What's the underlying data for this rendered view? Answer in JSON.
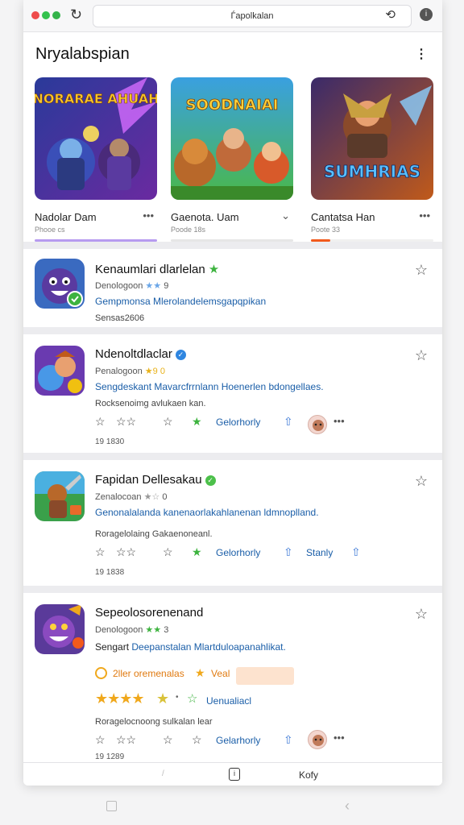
{
  "browser": {
    "url": "Ѓapolkalan",
    "reload_icon": "reload-icon",
    "action_icon": "refresh-icon",
    "info_icon": "info-icon"
  },
  "header": {
    "title": "Nryalabspian",
    "menu_icon": "more-vert-icon"
  },
  "carousel": [
    {
      "art": "NORARAE AHUAH",
      "title": "Nadolar Dam",
      "subtitle": "Phooe cs",
      "bar_color": "#b79bf0",
      "bar_fraction": 1.0
    },
    {
      "art": "SOODNAIAI",
      "title": "Gaenota. Uam",
      "subtitle": "Poode 18s",
      "bar_color": "#e6e6e6",
      "bar_fraction": 1.0
    },
    {
      "art": "SUMHRIAS",
      "title": "Cantatsa Han",
      "subtitle": "Poote 33",
      "bar_color": "#f25a1c",
      "bar_fraction": 0.16
    }
  ],
  "apps": [
    {
      "name": "Kenaumlari dlarlelan",
      "meta": "Denologoon",
      "rating": "9",
      "desc": "Gempmonsa Mlerolandelemsgapqpikan",
      "sub": "Sensas2606",
      "icon": "app-icon-purple-creature"
    },
    {
      "name": "Ndenoltdlaclar",
      "meta": "Penalogoon",
      "rating": "9 0",
      "desc_link": "Sengdeskant Mavarcfrrnlann",
      "desc_plain": "Hoenerlen bdongellaes.",
      "sub": "Rocksenoimg avlukaen kan.",
      "action": "Gelorhorly",
      "count": "19 1830",
      "icon": "app-icon-hero-blast"
    },
    {
      "name": "Fapidan Dellesakau",
      "meta": "Zenalocoan",
      "rating": "0",
      "desc": "Genonalalanda kanenaorlakahlanenan ldmnoplland.",
      "sub": "Roragelolaing Gakaenoneanl.",
      "action": "Gelorhorly",
      "action2": "Stanly",
      "count": "19 1838",
      "icon": "app-icon-warrior"
    },
    {
      "name": "Sepeolosorenenand",
      "meta": "Denologoon",
      "rating": "3",
      "desc_plain": "Sengart",
      "desc_link": "Deepanstalan Mlartduloapanahlikat.",
      "promo": "2ller oremenalas",
      "promo_link": "Veal",
      "rating_label": "Uenualiacl",
      "sub": "Roragelocnoong sulkalan lear",
      "action": "Gelarhorly",
      "count": "19 1289",
      "icon": "app-icon-grin-monster"
    }
  ],
  "bottom_bar": {
    "label": "Kofy",
    "mark": "/"
  },
  "colors": {
    "accent_blue": "#1a5ea8",
    "verify_green": "#4cc04a",
    "verify_blue": "#2f86e0",
    "star_green": "#3db33f",
    "star_gold": "#f0a81c"
  }
}
